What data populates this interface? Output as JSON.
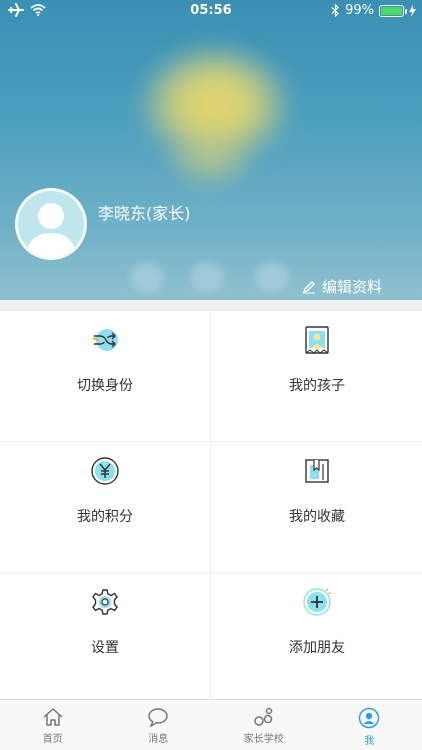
{
  "status_bar": {
    "time": "05:56",
    "battery_text": "99%",
    "battery_level": 0.99,
    "icons": [
      "airplane-icon",
      "wifi-icon",
      "bluetooth-icon",
      "charging-icon"
    ]
  },
  "profile": {
    "name": "李晓东(家长)",
    "edit_label": "编辑资料"
  },
  "menu": {
    "items": [
      {
        "label": "切换身份",
        "icon": "switch-identity-icon"
      },
      {
        "label": "我的孩子",
        "icon": "child-photo-icon"
      },
      {
        "label": "我的积分",
        "icon": "points-yen-icon"
      },
      {
        "label": "我的收藏",
        "icon": "favorites-book-icon"
      },
      {
        "label": "设置",
        "icon": "settings-gear-icon"
      },
      {
        "label": "添加朋友",
        "icon": "add-friend-icon"
      }
    ]
  },
  "tab_bar": {
    "tabs": [
      {
        "label": "首页",
        "icon": "home-icon"
      },
      {
        "label": "消息",
        "icon": "message-icon"
      },
      {
        "label": "家长学校",
        "icon": "parent-school-icon"
      },
      {
        "label": "我",
        "icon": "me-icon",
        "active": true
      }
    ],
    "active_color": "#2aa0e6"
  },
  "colors": {
    "header_bg": "#4d9fbf",
    "accent": "#2aa0e6",
    "icon_teal": "#8ee0ec"
  }
}
